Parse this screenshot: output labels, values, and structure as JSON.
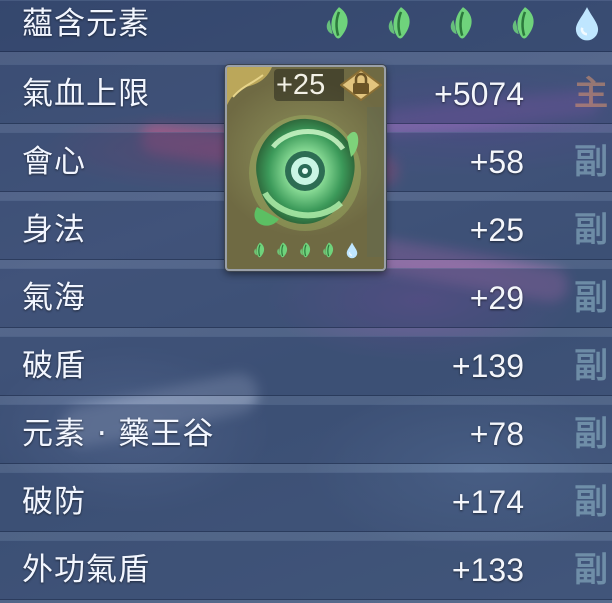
{
  "header": {
    "label": "蘊含元素",
    "elements": [
      "wood-leaf",
      "wood-leaf",
      "wood-leaf",
      "wood-leaf",
      "water-drop"
    ]
  },
  "stats": [
    {
      "label": "氣血上限",
      "value": "+5074",
      "tag": "主",
      "kind": "main"
    },
    {
      "label": "會心",
      "value": "+58",
      "tag": "副",
      "kind": "sub"
    },
    {
      "label": "身法",
      "value": "+25",
      "tag": "副",
      "kind": "sub"
    },
    {
      "label": "氣海",
      "value": "+29",
      "tag": "副",
      "kind": "sub"
    },
    {
      "label": "破盾",
      "value": "+139",
      "tag": "副",
      "kind": "sub"
    },
    {
      "label": "元素 · 藥王谷",
      "value": "+78",
      "tag": "副",
      "kind": "sub"
    },
    {
      "label": "破防",
      "value": "+174",
      "tag": "副",
      "kind": "sub"
    },
    {
      "label": "外功氣盾",
      "value": "+133",
      "tag": "副",
      "kind": "sub"
    }
  ],
  "item_card": {
    "level": "+25",
    "locked": true,
    "icon": "wood-element-orb-icon",
    "elements": [
      "wood-leaf",
      "wood-leaf",
      "wood-leaf",
      "wood-leaf",
      "water-drop"
    ]
  },
  "colors": {
    "leaf": "#6fd37c",
    "drop": "#bfe6ff",
    "main_tag": "#dc966e",
    "sub_tag": "#96bece"
  }
}
